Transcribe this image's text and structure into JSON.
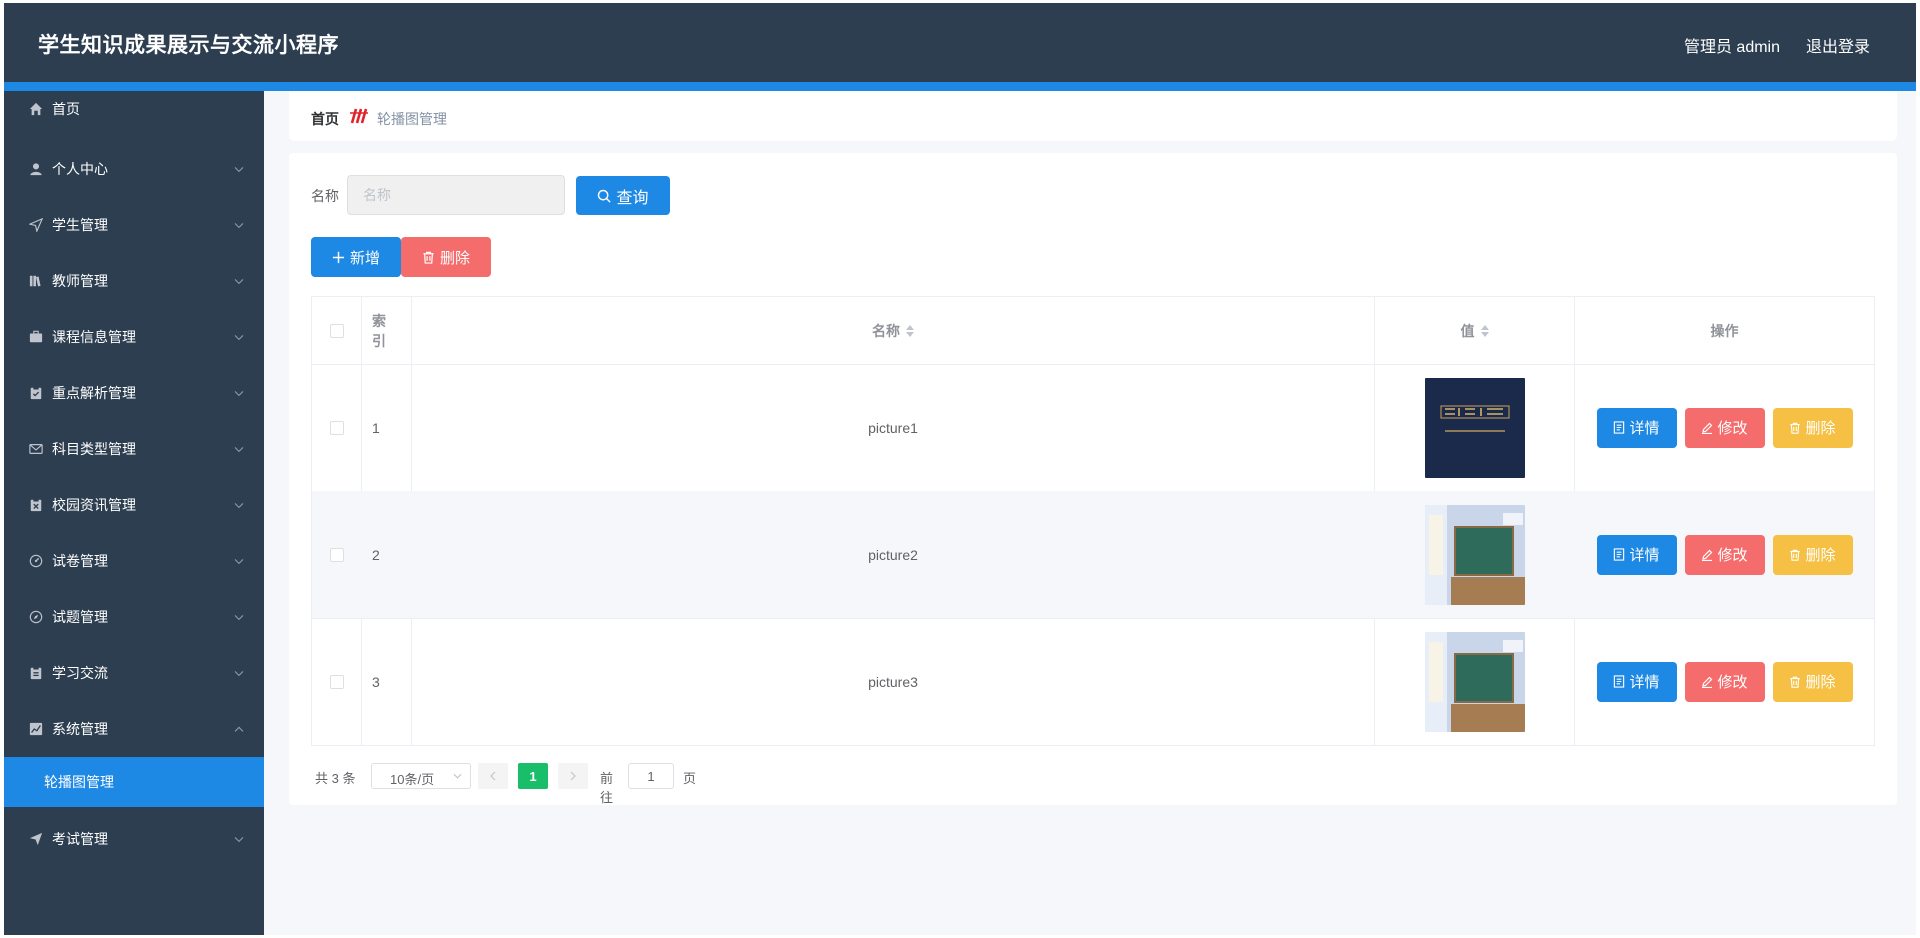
{
  "header": {
    "title": "学生知识成果展示与交流小程序",
    "user": "管理员 admin",
    "logout": "退出登录"
  },
  "sidebar": {
    "items": [
      {
        "label": "首页",
        "icon": "home-icon"
      },
      {
        "label": "个人中心",
        "icon": "user-icon"
      },
      {
        "label": "学生管理",
        "icon": "send-icon"
      },
      {
        "label": "教师管理",
        "icon": "books-icon"
      },
      {
        "label": "课程信息管理",
        "icon": "briefcase-icon"
      },
      {
        "label": "重点解析管理",
        "icon": "clipboard-icon"
      },
      {
        "label": "科目类型管理",
        "icon": "mail-icon"
      },
      {
        "label": "校园资讯管理",
        "icon": "clipboard-x-icon"
      },
      {
        "label": "试卷管理",
        "icon": "dashboard-icon"
      },
      {
        "label": "试题管理",
        "icon": "compass-icon"
      },
      {
        "label": "学习交流",
        "icon": "clipboard-check-icon"
      },
      {
        "label": "系统管理",
        "icon": "chart-icon"
      },
      {
        "label": "考试管理",
        "icon": "plane-icon"
      }
    ],
    "sub_item": "轮播图管理"
  },
  "breadcrumb": {
    "home": "首页",
    "current": "轮播图管理"
  },
  "search": {
    "label": "名称",
    "placeholder": "名称",
    "value": "",
    "button": "查询"
  },
  "actions": {
    "add": "新增",
    "delete": "删除"
  },
  "table": {
    "columns": {
      "index": "索引",
      "name": "名称",
      "value": "值",
      "ops": "操作"
    },
    "rows": [
      {
        "index": "1",
        "name": "picture1",
        "thumb": "dark-blue-book-cover"
      },
      {
        "index": "2",
        "name": "picture2",
        "thumb": "classroom-blackboard"
      },
      {
        "index": "3",
        "name": "picture3",
        "thumb": "classroom-blackboard"
      }
    ],
    "op_labels": {
      "detail": "详情",
      "edit": "修改",
      "remove": "删除"
    }
  },
  "pagination": {
    "total": "共 3 条",
    "page_size": "10条/页",
    "current_page": "1",
    "goto_label": "前往",
    "goto_value": "1",
    "page_unit": "页"
  },
  "colors": {
    "header_bg": "#2c3e50",
    "accent": "#1e88e5",
    "danger": "#f56c6c",
    "warning": "#f5c043",
    "page_active": "#19be6b"
  }
}
